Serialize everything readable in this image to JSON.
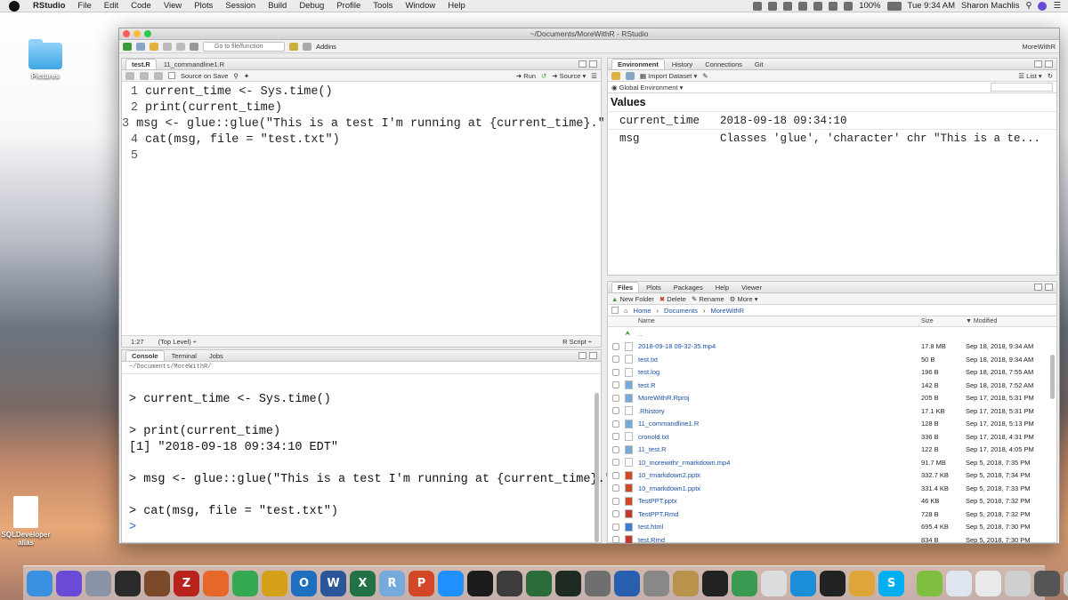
{
  "menubar": {
    "items": [
      "RStudio",
      "File",
      "Edit",
      "Code",
      "View",
      "Plots",
      "Session",
      "Build",
      "Debug",
      "Profile",
      "Tools",
      "Window",
      "Help"
    ],
    "battery": "100%",
    "clock": "Tue 9:34 AM",
    "user": "Sharon Machlis"
  },
  "desktop": {
    "pictures": "Pictures",
    "sqldev_line1": "SQLDeveloper",
    "sqldev_line2": "alias"
  },
  "window": {
    "title": "~/Documents/MoreWithR - RStudio",
    "goto_placeholder": "Go to file/function",
    "addins": "Addins",
    "project": "MoreWithR"
  },
  "editor": {
    "tabs": [
      "test.R",
      "11_commandline1.R"
    ],
    "source_on_save": "Source on Save",
    "run": "Run",
    "source": "Source",
    "lines": [
      "current_time <- Sys.time()",
      "print(current_time)",
      "msg <- glue::glue(\"This is a test I'm running at {current_time}.\")",
      "cat(msg, file = \"test.txt\")",
      ""
    ],
    "cursor_pos": "1:27",
    "scope": "(Top Level) ÷",
    "filetype": "R Script ÷"
  },
  "console": {
    "tabs": [
      "Console",
      "Terminal",
      "Jobs"
    ],
    "path": "~/Documents/MoreWithR/",
    "lines": [
      "",
      "> current_time <- Sys.time()",
      "",
      "> print(current_time)",
      "[1] \"2018-09-18 09:34:10 EDT\"",
      "",
      "> msg <- glue::glue(\"This is a test I'm running at {current_time}.\")",
      "",
      "> cat(msg, file = \"test.txt\")",
      ">"
    ]
  },
  "environment": {
    "tabs": [
      "Environment",
      "History",
      "Connections",
      "Git"
    ],
    "import_dataset": "Import Dataset",
    "list_label": "List",
    "scope": "Global Environment",
    "values_header": "Values",
    "rows": [
      {
        "name": "current_time",
        "value": "2018-09-18 09:34:10"
      },
      {
        "name": "msg",
        "value": "Classes 'glue', 'character' chr \"This is a te..."
      }
    ]
  },
  "files": {
    "tabs": [
      "Files",
      "Plots",
      "Packages",
      "Help",
      "Viewer"
    ],
    "new_folder": "New Folder",
    "delete": "Delete",
    "rename": "Rename",
    "more": "More",
    "breadcrumb": [
      "Home",
      "Documents",
      "MoreWithR"
    ],
    "col_name": "Name",
    "col_size": "Size",
    "col_modified": "Modified",
    "parent": "..",
    "rows": [
      {
        "name": "2018-09-18 09-32-35.mp4",
        "size": "17.8 MB",
        "modified": "Sep 18, 2018, 9:34 AM"
      },
      {
        "name": "test.txt",
        "size": "50 B",
        "modified": "Sep 18, 2018, 9:34 AM"
      },
      {
        "name": "test.log",
        "size": "196 B",
        "modified": "Sep 18, 2018, 7:55 AM"
      },
      {
        "name": "test.R",
        "size": "142 B",
        "modified": "Sep 18, 2018, 7:52 AM"
      },
      {
        "name": "MoreWithR.Rproj",
        "size": "205 B",
        "modified": "Sep 17, 2018, 5:31 PM"
      },
      {
        "name": ".Rhistory",
        "size": "17.1 KB",
        "modified": "Sep 17, 2018, 5:31 PM"
      },
      {
        "name": "11_commandline1.R",
        "size": "128 B",
        "modified": "Sep 17, 2018, 5:13 PM"
      },
      {
        "name": "cronold.txt",
        "size": "336 B",
        "modified": "Sep 17, 2018, 4:31 PM"
      },
      {
        "name": "11_test.R",
        "size": "122 B",
        "modified": "Sep 17, 2018, 4:05 PM"
      },
      {
        "name": "10_morewithr_rmarkdown.mp4",
        "size": "91.7 MB",
        "modified": "Sep 5, 2018, 7:35 PM"
      },
      {
        "name": "10_rmarkdown2.pptx",
        "size": "332.7 KB",
        "modified": "Sep 5, 2018, 7:34 PM"
      },
      {
        "name": "10_rmarkdown1.pptx",
        "size": "331.4 KB",
        "modified": "Sep 5, 2018, 7:33 PM"
      },
      {
        "name": "TestPPT.pptx",
        "size": "46 KB",
        "modified": "Sep 5, 2018, 7:32 PM"
      },
      {
        "name": "TestPPT.Rmd",
        "size": "728 B",
        "modified": "Sep 5, 2018, 7:32 PM"
      },
      {
        "name": "test.html",
        "size": "695.4 KB",
        "modified": "Sep 5, 2018, 7:30 PM"
      },
      {
        "name": "test.Rmd",
        "size": "834 B",
        "modified": "Sep 5, 2018, 7:30 PM"
      }
    ]
  },
  "dock": {
    "apps": [
      {
        "name": "finder",
        "color": "#3b8fe0"
      },
      {
        "name": "siri",
        "color": "#6a4bd8"
      },
      {
        "name": "launchpad",
        "color": "#8a94a6"
      },
      {
        "name": "mission-control",
        "color": "#2a2a2a"
      },
      {
        "name": "app-brown",
        "color": "#7a4a2a"
      },
      {
        "name": "filezilla",
        "color": "#b8231d"
      },
      {
        "name": "firefox",
        "color": "#e5682a"
      },
      {
        "name": "chrome",
        "color": "#34a853"
      },
      {
        "name": "app-yellow",
        "color": "#d4a017"
      },
      {
        "name": "outlook",
        "color": "#1e6fc0"
      },
      {
        "name": "word",
        "color": "#2b579a"
      },
      {
        "name": "excel",
        "color": "#217346"
      },
      {
        "name": "rstudio",
        "color": "#75aadb"
      },
      {
        "name": "powerpoint",
        "color": "#d24726"
      },
      {
        "name": "safari",
        "color": "#1e90ff"
      },
      {
        "name": "terminal",
        "color": "#1b1b1b"
      },
      {
        "name": "app-s",
        "color": "#3c3c3c"
      },
      {
        "name": "time-machine",
        "color": "#2b6d3a"
      },
      {
        "name": "activity-monitor",
        "color": "#1f2a22"
      },
      {
        "name": "system-prefs",
        "color": "#6f6f6f"
      },
      {
        "name": "xcode",
        "color": "#2a5fb0"
      },
      {
        "name": "calculator",
        "color": "#888"
      },
      {
        "name": "clock",
        "color": "#b9934b"
      },
      {
        "name": "console-app",
        "color": "#222"
      },
      {
        "name": "globe",
        "color": "#3a9a52"
      },
      {
        "name": "notes",
        "color": "#ddd"
      },
      {
        "name": "app-blue",
        "color": "#1c8ed8"
      },
      {
        "name": "obs",
        "color": "#222"
      },
      {
        "name": "db",
        "color": "#e0a53a"
      },
      {
        "name": "skype",
        "color": "#00aff0"
      },
      {
        "name": "installer",
        "color": "#7fbf3f"
      },
      {
        "name": "docs",
        "color": "#dfe5ee"
      },
      {
        "name": "files",
        "color": "#e9e9e9"
      },
      {
        "name": "list",
        "color": "#cfcfcf"
      },
      {
        "name": "screen",
        "color": "#555"
      },
      {
        "name": "trash",
        "color": "#c9c9c9"
      }
    ],
    "labels": {
      "firefox": "",
      "word": "W",
      "excel": "X",
      "rstudio": "R",
      "powerpoint": "P",
      "filezilla": "Z",
      "outlook": "O",
      "skype": "S"
    }
  }
}
